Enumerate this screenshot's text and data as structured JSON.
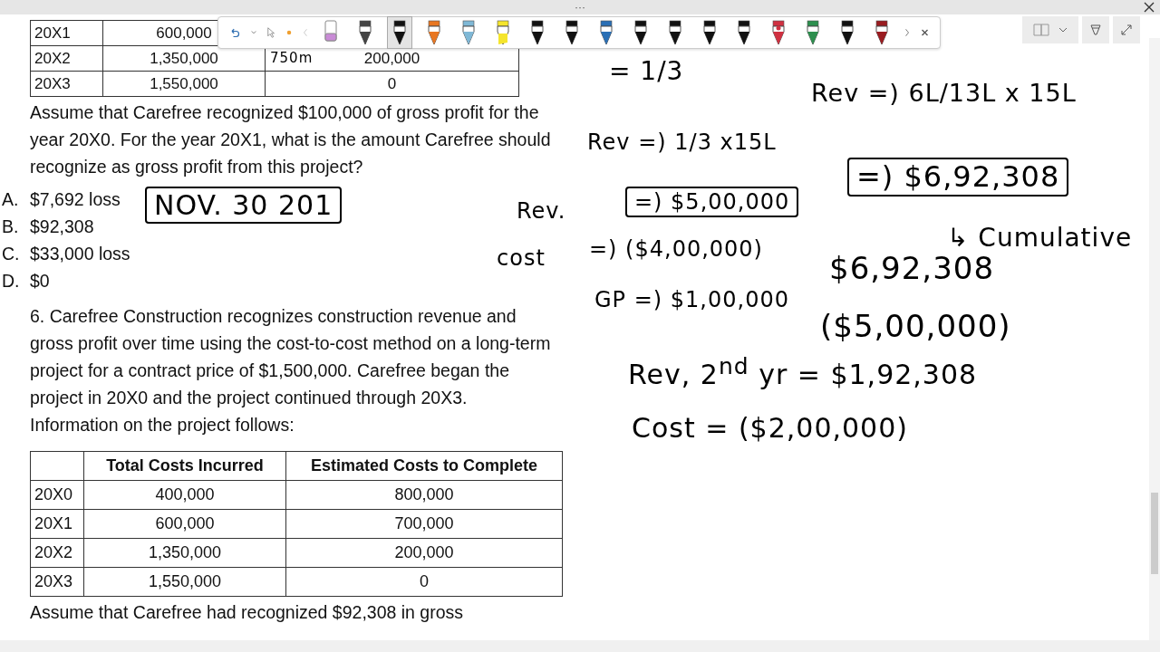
{
  "top_bar": {
    "more": "···"
  },
  "toolbar": {
    "pens": [
      {
        "kind": "eraser",
        "color": "#c98bd6",
        "selected": false
      },
      {
        "kind": "text-pen",
        "color": "#444444",
        "selected": false
      },
      {
        "kind": "pen",
        "color": "#111111",
        "selected": true
      },
      {
        "kind": "pen",
        "color": "#e87722",
        "selected": false
      },
      {
        "kind": "pen",
        "color": "#7fb8d6",
        "selected": false
      },
      {
        "kind": "highlighter",
        "color": "#f5e52c",
        "selected": false
      },
      {
        "kind": "pen",
        "color": "#111111",
        "selected": false
      },
      {
        "kind": "pen",
        "color": "#111111",
        "selected": false
      },
      {
        "kind": "pen",
        "color": "#2a6fb5",
        "selected": false
      },
      {
        "kind": "pen",
        "color": "#111111",
        "selected": false
      },
      {
        "kind": "pen",
        "color": "#111111",
        "selected": false
      },
      {
        "kind": "pen",
        "color": "#111111",
        "selected": false
      },
      {
        "kind": "pen",
        "color": "#111111",
        "selected": false
      },
      {
        "kind": "marker",
        "color": "#d03040",
        "selected": false
      },
      {
        "kind": "pen",
        "color": "#2d8f4e",
        "selected": false
      },
      {
        "kind": "pen",
        "color": "#111111",
        "selected": false
      },
      {
        "kind": "pen",
        "color": "#9a1c20",
        "selected": false
      }
    ]
  },
  "top_table": {
    "rows": [
      [
        "20X1",
        "600,000"
      ],
      [
        "20X2",
        "1,350,000",
        "200,000"
      ],
      [
        "20X3",
        "1,550,000",
        "0"
      ]
    ]
  },
  "question_5": {
    "text": "Assume that Carefree recognized $100,000 of gross profit for the year 20X0. For the year 20X1, what is the amount Carefree should recognize as gross profit from this project?",
    "options": [
      {
        "letter": "A.",
        "text": "$7,692 loss"
      },
      {
        "letter": "B.",
        "text": "$92,308"
      },
      {
        "letter": "C.",
        "text": "$33,000 loss"
      },
      {
        "letter": "D.",
        "text": "$0"
      }
    ]
  },
  "question_6": {
    "text": "6. Carefree Construction recognizes construction revenue and gross profit over time using the cost-to-cost method on a long-term project for a contract price of $1,500,000. Carefree began the project in 20X0 and the project continued through 20X3. Information on the project follows:",
    "table": {
      "columns": [
        "",
        "Total Costs Incurred",
        "Estimated Costs to Complete"
      ],
      "rows": [
        [
          "20X0",
          "400,000",
          "800,000"
        ],
        [
          "20X1",
          "600,000",
          "700,000"
        ],
        [
          "20X2",
          "1,350,000",
          "200,000"
        ],
        [
          "20X3",
          "1,550,000",
          "0"
        ]
      ]
    },
    "after": "Assume that Carefree had recognized $92,308 in gross"
  },
  "ink": [
    {
      "text": "750m",
      "boxed": false
    },
    {
      "text": "NOV. 30 201",
      "boxed": true
    },
    {
      "text": "= 1/3",
      "boxed": false
    },
    {
      "text": "Rev =) 1/3 x15L",
      "boxed": false
    },
    {
      "text": "Rev.",
      "boxed": false
    },
    {
      "text": "=) $5,00,000",
      "boxed": true
    },
    {
      "text": "cost",
      "boxed": false
    },
    {
      "text": "=) ($4,00,000)",
      "boxed": false
    },
    {
      "text": "GP =) $1,00,000",
      "boxed": false
    },
    {
      "text": "Rev =) 6L/13L x 15L",
      "boxed": false
    },
    {
      "text": "=) $6,92,308",
      "boxed": true
    },
    {
      "text": "↳ Cumulative",
      "boxed": false
    },
    {
      "text": "$6,92,308",
      "boxed": false
    },
    {
      "text": "($5,00,000)",
      "boxed": false
    },
    {
      "text": "Rev, 2$^{nd}$ yr = $1,92,308",
      "boxed": false
    },
    {
      "text": "Cost = ($2,00,000)",
      "boxed": false
    }
  ]
}
